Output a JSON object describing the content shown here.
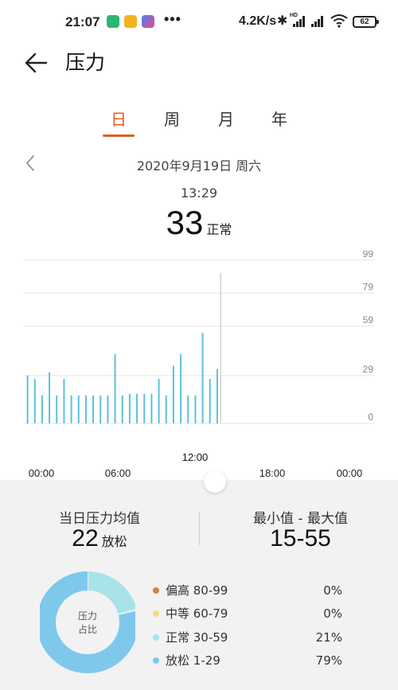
{
  "status_bar": {
    "time": "21:07",
    "dots": "•••",
    "network_speed": "4.2K/s",
    "hd_label": "HD",
    "battery": "62"
  },
  "header": {
    "title": "压力"
  },
  "tabs": [
    {
      "label": "日",
      "active": true
    },
    {
      "label": "周",
      "active": false
    },
    {
      "label": "月",
      "active": false
    },
    {
      "label": "年",
      "active": false
    }
  ],
  "date": "2020年9月19日 周六",
  "selected": {
    "time": "13:29",
    "value": "33",
    "status": "正常"
  },
  "chart_data": {
    "type": "bar",
    "x_ticks": [
      "00:00",
      "06:00",
      "12:00",
      "18:00",
      "00:00"
    ],
    "highlighted_tick": "12:00",
    "y_ticks": [
      "99",
      "79",
      "59",
      "29",
      "0"
    ],
    "ylim": [
      0,
      99
    ],
    "bar_color": "#5bc0de",
    "cursor_time": "13:29",
    "x": [
      "00:15",
      "00:45",
      "01:15",
      "01:45",
      "02:15",
      "02:45",
      "03:15",
      "03:45",
      "04:15",
      "04:45",
      "05:15",
      "05:45",
      "06:15",
      "06:45",
      "07:15",
      "07:45",
      "08:15",
      "08:45",
      "09:15",
      "09:45",
      "10:15",
      "10:45",
      "11:15",
      "11:45",
      "12:15",
      "12:45",
      "13:15"
    ],
    "values": [
      29,
      27,
      17,
      31,
      17,
      27,
      17,
      17,
      17,
      17,
      17,
      17,
      42,
      17,
      18,
      18,
      18,
      18,
      27,
      17,
      35,
      42,
      17,
      17,
      55,
      27,
      33
    ]
  },
  "summary": {
    "avg_label": "当日压力均值",
    "avg_value": "22",
    "avg_unit": "放松",
    "range_label": "最小值 - 最大值",
    "range_value": "15-55"
  },
  "donut": {
    "center_line1": "压力",
    "center_line2": "占比",
    "segments": [
      {
        "label": "偏高 80-99",
        "percent": "0%",
        "value": 0,
        "color": "#c8893e"
      },
      {
        "label": "中等 60-79",
        "percent": "0%",
        "value": 0,
        "color": "#f3d98c"
      },
      {
        "label": "正常 30-59",
        "percent": "21%",
        "value": 21,
        "color": "#a8e3ea"
      },
      {
        "label": "放松 1-29",
        "percent": "79%",
        "value": 79,
        "color": "#7ec8ec"
      }
    ]
  }
}
